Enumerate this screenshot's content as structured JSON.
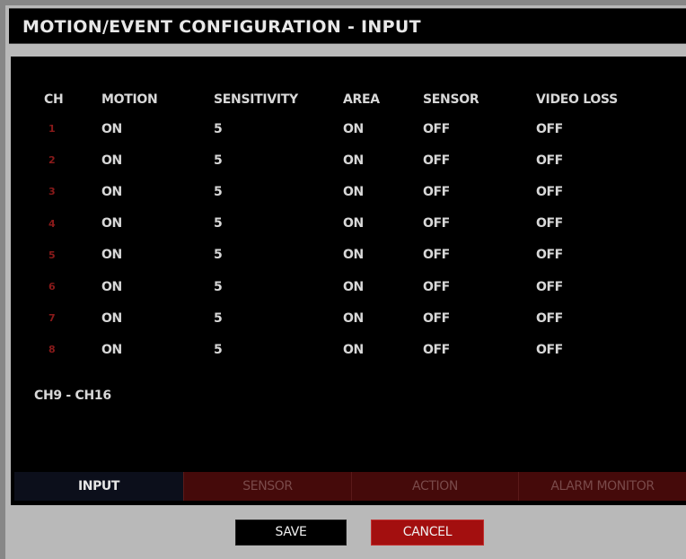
{
  "title": "MOTION/EVENT CONFIGURATION - INPUT",
  "table": {
    "headers": [
      "CH",
      "MOTION",
      "SENSITIVITY",
      "AREA",
      "SENSOR",
      "VIDEO LOSS"
    ],
    "rows": [
      [
        "1",
        "ON",
        "5",
        "ON",
        "OFF",
        "OFF"
      ],
      [
        "2",
        "ON",
        "5",
        "ON",
        "OFF",
        "OFF"
      ],
      [
        "3",
        "ON",
        "5",
        "ON",
        "OFF",
        "OFF"
      ],
      [
        "4",
        "ON",
        "5",
        "ON",
        "OFF",
        "OFF"
      ],
      [
        "5",
        "ON",
        "5",
        "ON",
        "OFF",
        "OFF"
      ],
      [
        "6",
        "ON",
        "5",
        "ON",
        "OFF",
        "OFF"
      ],
      [
        "7",
        "ON",
        "5",
        "ON",
        "OFF",
        "OFF"
      ],
      [
        "8",
        "ON",
        "5",
        "ON",
        "OFF",
        "OFF"
      ]
    ]
  },
  "channel_range_label": "CH9 - CH16",
  "tabs": [
    {
      "label": "INPUT",
      "active": true
    },
    {
      "label": "SENSOR",
      "active": false
    },
    {
      "label": "ACTION",
      "active": false
    },
    {
      "label": "ALARM MONITOR",
      "active": false
    }
  ],
  "buttons": {
    "save": "SAVE",
    "cancel": "CANCEL"
  },
  "colors": {
    "background": "#878787",
    "panel": "#000000",
    "active_tab": "#0c0f1b",
    "inactive_tab": "#450a0a",
    "cancel_button": "#a30f0f",
    "channel_number": "#8a1a1a"
  }
}
